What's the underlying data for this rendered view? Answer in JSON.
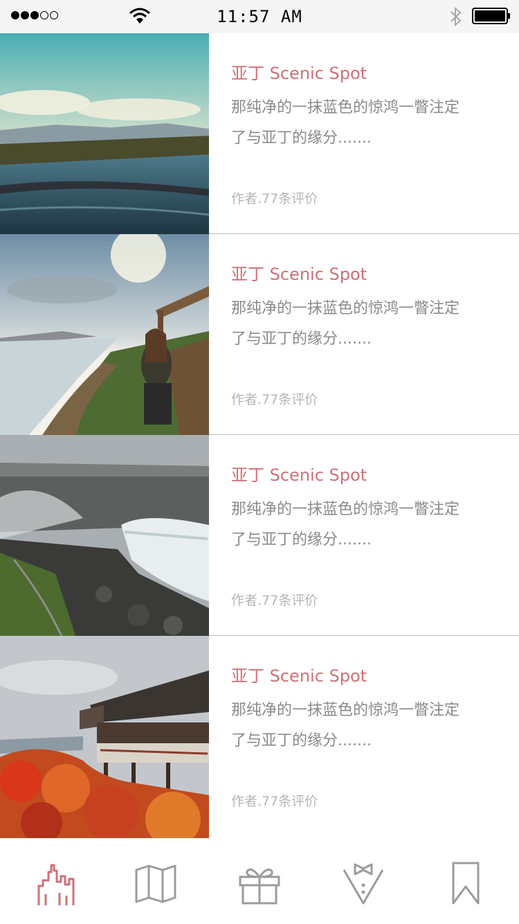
{
  "status_bar": {
    "time": "11:57 AM",
    "signal_icon": "signal-dots-icon",
    "wifi_icon": "wifi-icon",
    "bluetooth_icon": "bluetooth-icon",
    "battery_icon": "battery-icon"
  },
  "colors": {
    "accent": "#d16f78",
    "text_secondary": "#8a8a8a",
    "text_meta": "#b5b5b5",
    "icon_gray": "#9b9b9b"
  },
  "spots": [
    {
      "title": "亚丁 Scenic Spot",
      "description": "那纯净的一抹蓝色的惊鸿一瞥注定了与亚丁的缘分.......",
      "meta": "作者.77条评价",
      "image": "lake-landscape-photo"
    },
    {
      "title": "亚丁 Scenic Spot",
      "description": "那纯净的一抹蓝色的惊鸿一瞥注定了与亚丁的缘分.......",
      "meta": "作者.77条评价",
      "image": "person-on-bench-coast-photo"
    },
    {
      "title": "亚丁 Scenic Spot",
      "description": "那纯净的一抹蓝色的惊鸿一瞥注定了与亚丁的缘分.......",
      "meta": "作者.77条评价",
      "image": "waterfall-canyon-photo"
    },
    {
      "title": "亚丁 Scenic Spot",
      "description": "那纯净的一抹蓝色的惊鸿一瞥注定了与亚丁的缘分.......",
      "meta": "作者.77条评价",
      "image": "temple-autumn-photo"
    }
  ],
  "tab_bar": {
    "active_index": 0,
    "tabs": [
      {
        "icon": "city-skyline-icon"
      },
      {
        "icon": "map-icon"
      },
      {
        "icon": "gift-icon"
      },
      {
        "icon": "tuxedo-bowtie-icon"
      },
      {
        "icon": "bookmark-icon"
      }
    ]
  }
}
